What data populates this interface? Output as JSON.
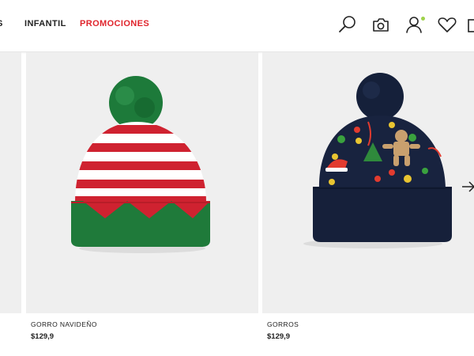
{
  "nav": {
    "partial_label": "S",
    "infantil_label": "INFANTIL",
    "promociones_label": "PROMOCIONES",
    "promo_color": "#e0252d"
  },
  "header_icons": [
    "search-icon",
    "camera-icon",
    "user-icon",
    "heart-icon",
    "bag-icon"
  ],
  "products": [
    {
      "name": "GORRO NAVIDEÑO",
      "price": "$129,9"
    },
    {
      "name": "GORROS",
      "price": "$129,9"
    }
  ],
  "colors": {
    "accent_red": "#e0252d",
    "status_dot": "#9fd24a",
    "image_bg": "#efefef"
  }
}
